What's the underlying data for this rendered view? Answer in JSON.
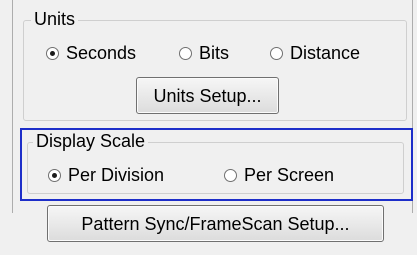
{
  "units": {
    "legend": "Units",
    "options": [
      {
        "label": "Seconds",
        "selected": true
      },
      {
        "label": "Bits",
        "selected": false
      },
      {
        "label": "Distance",
        "selected": false
      }
    ],
    "setup_button": "Units Setup..."
  },
  "display_scale": {
    "legend": "Display Scale",
    "options": [
      {
        "label": "Per Division",
        "selected": true
      },
      {
        "label": "Per Screen",
        "selected": false
      }
    ]
  },
  "pattern_sync_button": "Pattern Sync/FrameScan Setup...",
  "colors": {
    "focus_border": "#1d2ec9",
    "window_bg": "#f0f0f0"
  }
}
